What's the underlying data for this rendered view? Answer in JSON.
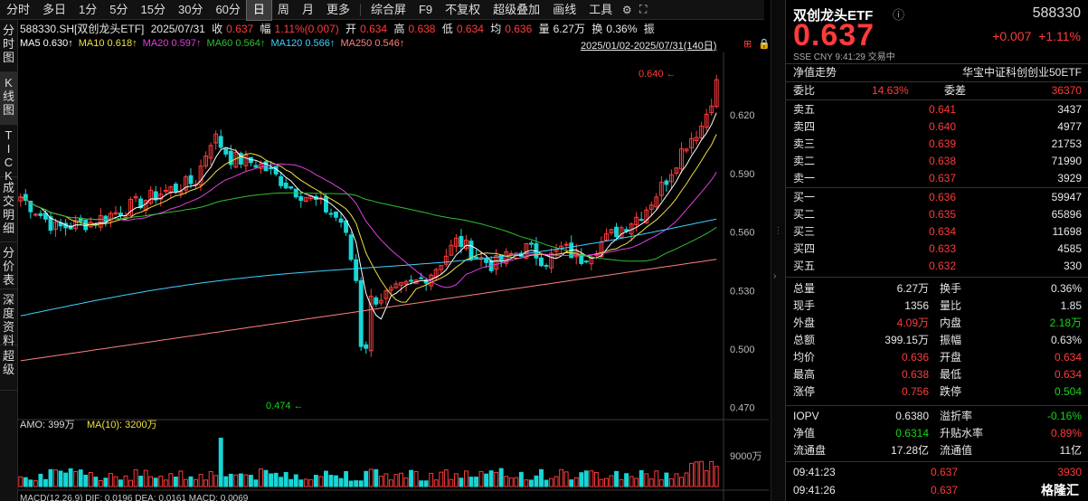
{
  "toolbar": {
    "items": [
      "分时",
      "多日",
      "1分",
      "5分",
      "15分",
      "30分",
      "60分",
      "日",
      "周",
      "月",
      "更多"
    ],
    "active": "日",
    "right_items": [
      "综合屏",
      "F9",
      "不复权",
      "超级叠加",
      "画线",
      "工具"
    ]
  },
  "left_tabs": [
    "分时图",
    "K线图",
    "TICK",
    "成交明细",
    "分价表",
    "深度资料",
    "超级"
  ],
  "info": {
    "code": "588330.SH[双创龙头ETF]",
    "date": "2025/07/31",
    "close_label": "收",
    "close": "0.637",
    "range_label": "幅",
    "range": "1.11%(0.007)",
    "open_label": "开",
    "open": "0.634",
    "high_label": "高",
    "high": "0.638",
    "low_label": "低",
    "low": "0.634",
    "avg_label": "均",
    "avg": "0.636",
    "vol_label": "量",
    "vol": "6.27万",
    "turn_label": "换",
    "turn": "0.36%",
    "amp_label": "振"
  },
  "ma": {
    "ma5": "MA5 0.630↑",
    "ma10": "MA10 0.618↑",
    "ma20": "MA20 0.597↑",
    "ma60": "MA60 0.564↑",
    "ma120": "MA120 0.566↑",
    "ma250": "MA250 0.546↑",
    "period": "2025/01/02-2025/07/31(140日)"
  },
  "price_axis": [
    "0.620",
    "0.590",
    "0.560",
    "0.530",
    "0.500",
    "0.470"
  ],
  "annotations": {
    "high_mark": "0.640",
    "low_mark": "0.474"
  },
  "volume": {
    "amo": "AMO: 399万",
    "ma10": "MA(10): 3200万",
    "axis": "9000万"
  },
  "macd": {
    "text": "MACD(12,26,9) DIF: 0.0196 DEA: 0.0161 MACD: 0.0069"
  },
  "quote": {
    "name": "双创龙头ETF",
    "code": "588330",
    "price": "0.637",
    "change": "+0.007",
    "change_pct": "+1.11%",
    "meta": "SSE  CNY  9:41:29  交易中",
    "nav_trend": "净值走势",
    "index_name": "华宝中证科创创业50ETF",
    "wb_label": "委比",
    "wb": "14.63%",
    "wc_label": "委差",
    "wc": "36370",
    "asks": [
      {
        "label": "卖五",
        "price": "0.641",
        "vol": "3437"
      },
      {
        "label": "卖四",
        "price": "0.640",
        "vol": "4977"
      },
      {
        "label": "卖三",
        "price": "0.639",
        "vol": "21753"
      },
      {
        "label": "卖二",
        "price": "0.638",
        "vol": "71990"
      },
      {
        "label": "卖一",
        "price": "0.637",
        "vol": "3929"
      }
    ],
    "bids": [
      {
        "label": "买一",
        "price": "0.636",
        "vol": "59947"
      },
      {
        "label": "买二",
        "price": "0.635",
        "vol": "65896"
      },
      {
        "label": "买三",
        "price": "0.634",
        "vol": "11698"
      },
      {
        "label": "买四",
        "price": "0.633",
        "vol": "4585"
      },
      {
        "label": "买五",
        "price": "0.632",
        "vol": "330"
      }
    ],
    "stats": [
      {
        "a": "总量",
        "b": "6.27万",
        "bc": "white",
        "c": "换手",
        "d": "0.36%",
        "dc": "white"
      },
      {
        "a": "现手",
        "b": "1356",
        "bc": "white",
        "c": "量比",
        "d": "1.85",
        "dc": "white"
      },
      {
        "a": "外盘",
        "b": "4.09万",
        "bc": "red",
        "c": "内盘",
        "d": "2.18万",
        "dc": "green"
      },
      {
        "a": "总额",
        "b": "399.15万",
        "bc": "white",
        "c": "振幅",
        "d": "0.63%",
        "dc": "white"
      },
      {
        "a": "均价",
        "b": "0.636",
        "bc": "red",
        "c": "开盘",
        "d": "0.634",
        "dc": "red"
      },
      {
        "a": "最高",
        "b": "0.638",
        "bc": "red",
        "c": "最低",
        "d": "0.634",
        "dc": "red"
      },
      {
        "a": "涨停",
        "b": "0.756",
        "bc": "red",
        "c": "跌停",
        "d": "0.504",
        "dc": "green"
      }
    ],
    "stats2": [
      {
        "a": "IOPV",
        "b": "0.6380",
        "bc": "white",
        "c": "溢折率",
        "d": "-0.16%",
        "dc": "green"
      },
      {
        "a": "净值",
        "b": "0.6314",
        "bc": "green",
        "c": "升贴水率",
        "d": "0.89%",
        "dc": "red"
      },
      {
        "a": "流通盘",
        "b": "17.28亿",
        "bc": "white",
        "c": "流通值",
        "d": "11亿",
        "dc": "white"
      }
    ],
    "ticks": [
      {
        "t": "09:41:23",
        "p": "0.637",
        "v": "3930"
      },
      {
        "t": "09:41:26",
        "p": "0.637",
        "v": ""
      }
    ],
    "watermark": "格隆汇"
  },
  "colors": {
    "up": "#ff3b3b",
    "down": "#17d6d6",
    "ma5": "#ffffff",
    "ma10": "#f0e040",
    "ma20": "#e040e0",
    "ma60": "#30c030",
    "ma120": "#40d0ff",
    "ma250": "#ff8080"
  }
}
